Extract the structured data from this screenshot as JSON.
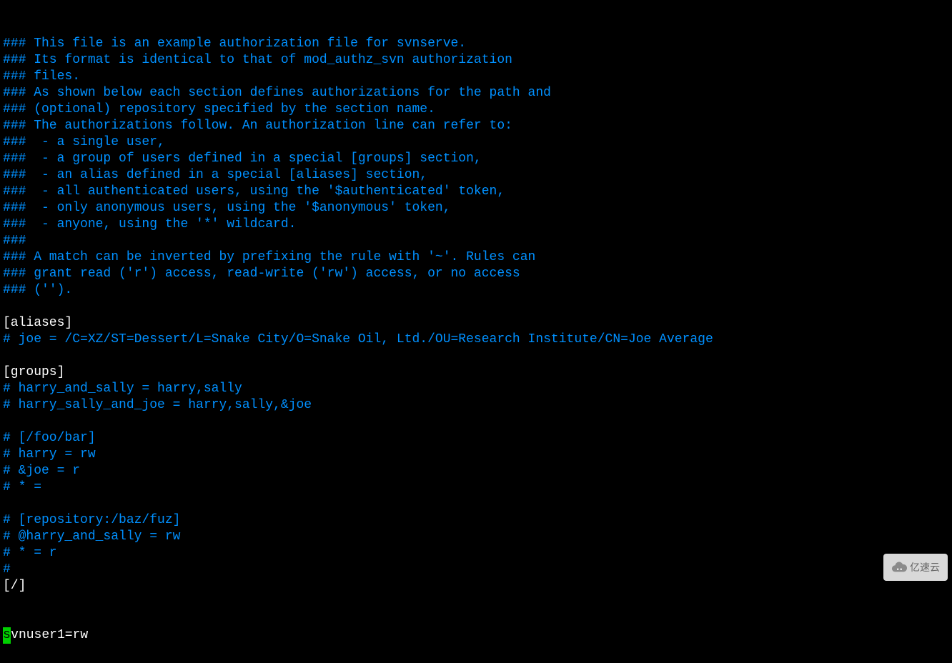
{
  "lines": [
    {
      "cls": "comment",
      "text": "### This file is an example authorization file for svnserve."
    },
    {
      "cls": "comment",
      "text": "### Its format is identical to that of mod_authz_svn authorization"
    },
    {
      "cls": "comment",
      "text": "### files."
    },
    {
      "cls": "comment",
      "text": "### As shown below each section defines authorizations for the path and"
    },
    {
      "cls": "comment",
      "text": "### (optional) repository specified by the section name."
    },
    {
      "cls": "comment",
      "text": "### The authorizations follow. An authorization line can refer to:"
    },
    {
      "cls": "comment",
      "text": "###  - a single user,"
    },
    {
      "cls": "comment",
      "text": "###  - a group of users defined in a special [groups] section,"
    },
    {
      "cls": "comment",
      "text": "###  - an alias defined in a special [aliases] section,"
    },
    {
      "cls": "comment",
      "text": "###  - all authenticated users, using the '$authenticated' token,"
    },
    {
      "cls": "comment",
      "text": "###  - only anonymous users, using the '$anonymous' token,"
    },
    {
      "cls": "comment",
      "text": "###  - anyone, using the '*' wildcard."
    },
    {
      "cls": "comment",
      "text": "###"
    },
    {
      "cls": "comment",
      "text": "### A match can be inverted by prefixing the rule with '~'. Rules can"
    },
    {
      "cls": "comment",
      "text": "### grant read ('r') access, read-write ('rw') access, or no access"
    },
    {
      "cls": "comment",
      "text": "### ('')."
    },
    {
      "cls": "plain",
      "text": ""
    },
    {
      "cls": "section",
      "text": "[aliases]"
    },
    {
      "cls": "comment",
      "text": "# joe = /C=XZ/ST=Dessert/L=Snake City/O=Snake Oil, Ltd./OU=Research Institute/CN=Joe Average"
    },
    {
      "cls": "plain",
      "text": ""
    },
    {
      "cls": "section",
      "text": "[groups]"
    },
    {
      "cls": "comment",
      "text": "# harry_and_sally = harry,sally"
    },
    {
      "cls": "comment",
      "text": "# harry_sally_and_joe = harry,sally,&joe"
    },
    {
      "cls": "plain",
      "text": ""
    },
    {
      "cls": "comment",
      "text": "# [/foo/bar]"
    },
    {
      "cls": "comment",
      "text": "# harry = rw"
    },
    {
      "cls": "comment",
      "text": "# &joe = r"
    },
    {
      "cls": "comment",
      "text": "# * ="
    },
    {
      "cls": "plain",
      "text": ""
    },
    {
      "cls": "comment",
      "text": "# [repository:/baz/fuz]"
    },
    {
      "cls": "comment",
      "text": "# @harry_and_sally = rw"
    },
    {
      "cls": "comment",
      "text": "# * = r"
    },
    {
      "cls": "comment",
      "text": "#"
    },
    {
      "cls": "section",
      "text": "[/]"
    }
  ],
  "cursor_line": {
    "cursor_char": "s",
    "rest": "vnuser1=rw"
  },
  "watermark": {
    "text": "亿速云"
  }
}
